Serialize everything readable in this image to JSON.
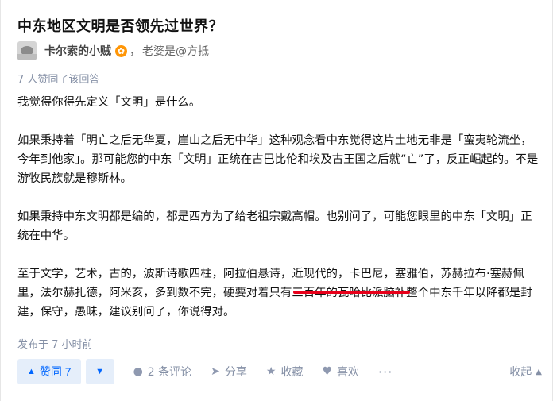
{
  "question": {
    "title": "中东地区文明是否领先过世界？"
  },
  "author": {
    "name": "卡尔索的小贼",
    "separator": "，",
    "bio": "老婆是@方抵"
  },
  "answer": {
    "vote_summary": "7 人赞同了该回答",
    "paragraphs": [
      "我觉得你得先定义「文明」是什么。",
      "如果秉持着「明亡之后无华夏，崖山之后无中华」这种观念看中东觉得这片土地无非是「蛮夷轮流坐，今年到他家」。那可能您的中东「文明」正统在古巴比伦和埃及古王国之后就“亡”了，反正崛起的。不是游牧民族就是穆斯林。",
      "如果秉持中东文明都是编的，都是西方为了给老祖宗戴高帽。也别问了，可能您眼里的中东「文明」正统在中华。",
      "至于文学，艺术，古的，波斯诗歌四柱，阿拉伯悬诗，近现代的，卡巴尼，塞雅伯，苏赫拉布·塞赫佩里，法尔赫扎德，阿米亥，多到数不完，硬要对着只有三百年的瓦哈比派脑补整个中东千年以降都是封建，保守，愚昧，建议别问了，你说得对。"
    ],
    "published": "发布于 7 小时前"
  },
  "actions": {
    "upvote_label": "赞同 7",
    "comments_label": "2 条评论",
    "share_label": "分享",
    "favorite_label": "收藏",
    "like_label": "喜欢",
    "more_label": "···",
    "collapse_label": "收起"
  },
  "icons": {
    "badge": "star-badge-icon",
    "upvote": "triangle-up-icon",
    "downvote": "triangle-down-icon",
    "comment": "comment-bubble-icon",
    "share": "paper-plane-icon",
    "favorite": "star-icon",
    "like": "heart-icon",
    "collapse": "chevron-up-icon"
  },
  "colors": {
    "accent": "#0066ff",
    "accent_bg": "#e5eefa",
    "badge": "#ff9607",
    "highlight_underline": "#e8001a",
    "meta_text": "#8590a6"
  }
}
